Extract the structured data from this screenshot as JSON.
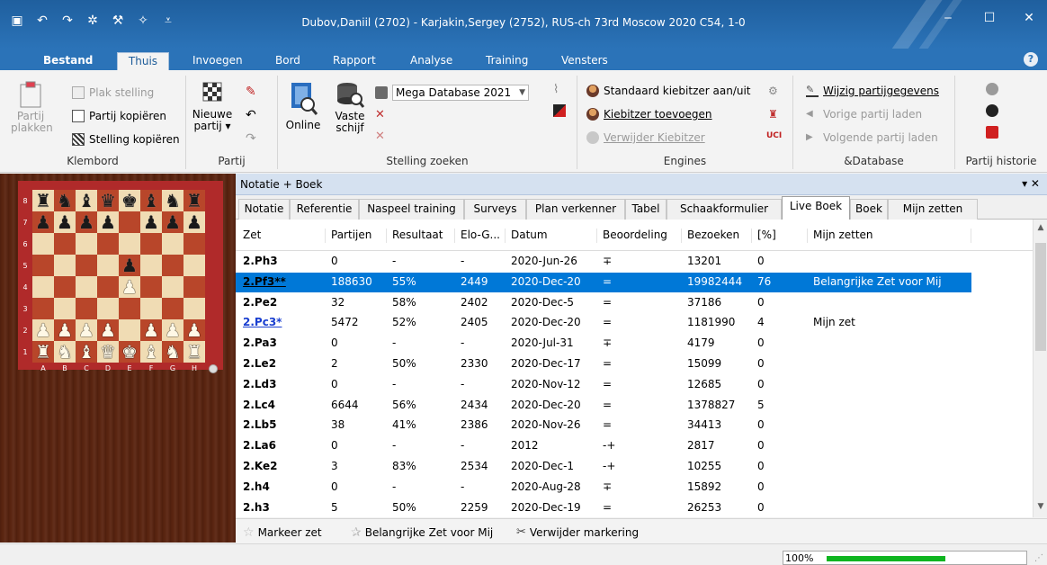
{
  "window": {
    "title": "Dubov,Daniil (2702) - Karjakin,Sergey (2752), RUS-ch 73rd Moscow 2020  C54, 1-0",
    "minimize": "‒",
    "maximize": "☐",
    "close": "✕"
  },
  "ribbon_tabs": [
    "Bestand",
    "Thuis",
    "Invoegen",
    "Bord",
    "Rapport",
    "Analyse",
    "Training",
    "Vensters"
  ],
  "help": "?",
  "klembord": {
    "plakken_line1": "Partij",
    "plakken_line2": "plakken",
    "plak_stelling": "Plak stelling",
    "partij_kopieren": "Partij kopiëren",
    "stelling_kopieren": "Stelling kopiëren",
    "label": "Klembord"
  },
  "partij": {
    "nieuwe_line1": "Nieuwe",
    "nieuwe_line2": "partij ▾",
    "label": "Partij"
  },
  "stelling_zoeken": {
    "online": "Online",
    "vaste_line1": "Vaste",
    "vaste_line2": "schijf",
    "database": "Mega Database 2021",
    "label": "Stelling zoeken"
  },
  "engines": {
    "standaard": "Standaard kiebitzer aan/uit",
    "toevoegen": "Kiebitzer toevoegen",
    "verwijder": "Verwijder Kiebitzer",
    "label": "Engines"
  },
  "database": {
    "wijzig": "Wijzig partijgegevens",
    "vorige": "Vorige partij laden",
    "volgende": "Volgende partij laden",
    "label": "&Database"
  },
  "historie": {
    "label": "Partij historie"
  },
  "panel": {
    "title": "Notatie + Boek",
    "buttons": "▾ ✕"
  },
  "subtabs": [
    "Notatie",
    "Referentie",
    "Naspeel training",
    "Surveys",
    "Plan verkenner",
    "Tabel",
    "Schaakformulier",
    "Live Boek",
    "Boek",
    "Mijn zetten"
  ],
  "columns": [
    "Zet",
    "Partijen",
    "Resultaat",
    "Elo-G...",
    "Datum",
    "Beoordeling",
    "Bezoeken",
    "[%]",
    "Mijn zetten"
  ],
  "rows": [
    {
      "zet": "2.Ph3",
      "partijen": "0",
      "resultaat": "-",
      "elo": "-",
      "datum": "2020-Jun-26",
      "beoordeling": "∓",
      "bezoeken": "13201",
      "pct": "0",
      "mijn": ""
    },
    {
      "zet": "2.Pf3**",
      "partijen": "188630",
      "resultaat": "55%",
      "elo": "2449",
      "datum": "2020-Dec-20",
      "beoordeling": "=",
      "bezoeken": "19982444",
      "pct": "76",
      "mijn": "Belangrijke Zet voor Mij"
    },
    {
      "zet": "2.Pe2",
      "partijen": "32",
      "resultaat": "58%",
      "elo": "2402",
      "datum": "2020-Dec-5",
      "beoordeling": "=",
      "bezoeken": "37186",
      "pct": "0",
      "mijn": ""
    },
    {
      "zet": "2.Pc3*",
      "partijen": "5472",
      "resultaat": "52%",
      "elo": "2405",
      "datum": "2020-Dec-20",
      "beoordeling": "=",
      "bezoeken": "1181990",
      "pct": "4",
      "mijn": "Mijn zet"
    },
    {
      "zet": "2.Pa3",
      "partijen": "0",
      "resultaat": "-",
      "elo": "-",
      "datum": "2020-Jul-31",
      "beoordeling": "∓",
      "bezoeken": "4179",
      "pct": "0",
      "mijn": ""
    },
    {
      "zet": "2.Le2",
      "partijen": "2",
      "resultaat": "50%",
      "elo": "2330",
      "datum": "2020-Dec-17",
      "beoordeling": "=",
      "bezoeken": "15099",
      "pct": "0",
      "mijn": ""
    },
    {
      "zet": "2.Ld3",
      "partijen": "0",
      "resultaat": "-",
      "elo": "-",
      "datum": "2020-Nov-12",
      "beoordeling": "=",
      "bezoeken": "12685",
      "pct": "0",
      "mijn": ""
    },
    {
      "zet": "2.Lc4",
      "partijen": "6644",
      "resultaat": "56%",
      "elo": "2434",
      "datum": "2020-Dec-20",
      "beoordeling": "=",
      "bezoeken": "1378827",
      "pct": "5",
      "mijn": ""
    },
    {
      "zet": "2.Lb5",
      "partijen": "38",
      "resultaat": "41%",
      "elo": "2386",
      "datum": "2020-Nov-26",
      "beoordeling": "=",
      "bezoeken": "34413",
      "pct": "0",
      "mijn": ""
    },
    {
      "zet": "2.La6",
      "partijen": "0",
      "resultaat": "-",
      "elo": "-",
      "datum": "2012",
      "beoordeling": "-+",
      "bezoeken": "2817",
      "pct": "0",
      "mijn": ""
    },
    {
      "zet": "2.Ke2",
      "partijen": "3",
      "resultaat": "83%",
      "elo": "2534",
      "datum": "2020-Dec-1",
      "beoordeling": "-+",
      "bezoeken": "10255",
      "pct": "0",
      "mijn": ""
    },
    {
      "zet": "2.h4",
      "partijen": "0",
      "resultaat": "-",
      "elo": "-",
      "datum": "2020-Aug-28",
      "beoordeling": "∓",
      "bezoeken": "15892",
      "pct": "0",
      "mijn": ""
    },
    {
      "zet": "2.h3",
      "partijen": "5",
      "resultaat": "50%",
      "elo": "2259",
      "datum": "2020-Dec-19",
      "beoordeling": "=",
      "bezoeken": "26253",
      "pct": "0",
      "mijn": ""
    }
  ],
  "bottom": {
    "markeer": "Markeer zet",
    "belangrijk": "Belangrijke Zet voor Mij",
    "verwijder": "Verwijder markering"
  },
  "status": {
    "zoom": "100%",
    "zoom_fraction": 0.6
  },
  "board": {
    "ranks": [
      "8",
      "7",
      "6",
      "5",
      "4",
      "3",
      "2",
      "1"
    ],
    "files": [
      "A",
      "B",
      "C",
      "D",
      "E",
      "F",
      "G",
      "H"
    ],
    "position": [
      "rnbqkbnr",
      "pppp.ppp",
      "........",
      "....p...",
      "....P...",
      "........",
      "PPPP.PPP",
      "RNBQKBNR"
    ]
  }
}
